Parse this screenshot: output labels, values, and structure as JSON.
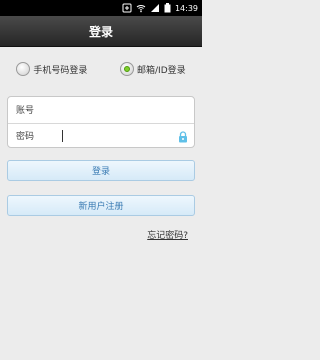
{
  "status_bar": {
    "time": "14:39",
    "icons": [
      "notification-icon",
      "wifi-icon",
      "signal-icon",
      "battery-icon"
    ]
  },
  "header": {
    "title": "登录"
  },
  "login_mode": {
    "options": [
      {
        "label": "手机号码登录",
        "selected": false
      },
      {
        "label": "邮箱/ID登录",
        "selected": true
      }
    ]
  },
  "form": {
    "account_label": "账号",
    "password_label": "密码"
  },
  "buttons": {
    "login": "登录",
    "register": "新用户注册"
  },
  "links": {
    "forgot_password": "忘记密码?"
  },
  "colors": {
    "accent": "#3a7bb3",
    "radio_selected": "#7fcf2a",
    "lock": "#5fc0e8"
  }
}
